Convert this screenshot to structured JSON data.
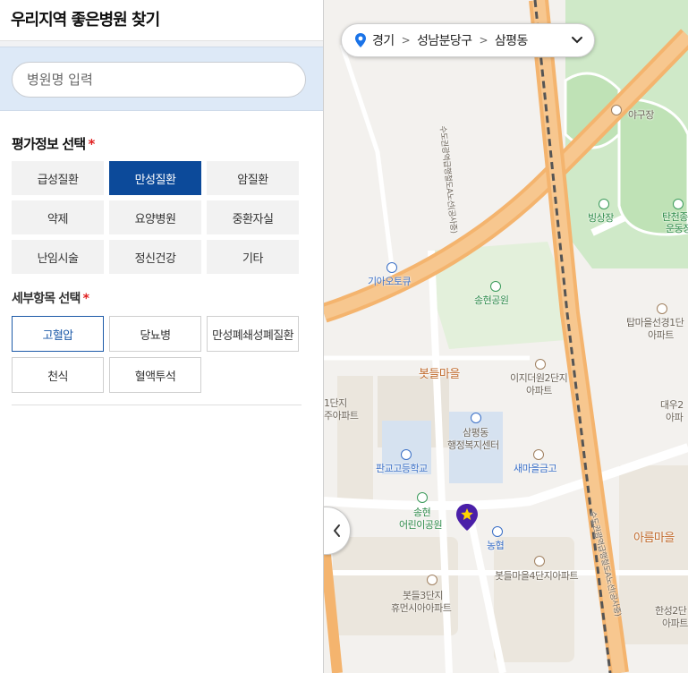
{
  "panel": {
    "title": "우리지역 좋은병원 찾기",
    "search_placeholder": "병원명 입력",
    "eval_title": "평가정보 선택",
    "required_mark": "*",
    "eval_items": [
      {
        "label": "급성질환",
        "active": false
      },
      {
        "label": "만성질환",
        "active": true
      },
      {
        "label": "암질환",
        "active": false
      },
      {
        "label": "약제",
        "active": false
      },
      {
        "label": "요양병원",
        "active": false
      },
      {
        "label": "중환자실",
        "active": false
      },
      {
        "label": "난임시술",
        "active": false
      },
      {
        "label": "정신건강",
        "active": false
      },
      {
        "label": "기타",
        "active": false
      }
    ],
    "detail_title": "세부항목 선택",
    "detail_items": [
      {
        "label": "고혈압",
        "active": true
      },
      {
        "label": "당뇨병",
        "active": false
      },
      {
        "label": "만성폐쇄성폐질환",
        "active": false
      },
      {
        "label": "천식",
        "active": false
      },
      {
        "label": "혈액투석",
        "active": false
      }
    ]
  },
  "map": {
    "breadcrumb": [
      "경기",
      "성남분당구",
      "삼평동"
    ],
    "labels": {
      "baseball": "야구장",
      "ice_rink": "빙상장",
      "tancheon_1": "탄천종",
      "tancheon_2": "운동장",
      "kia": "기아오토큐",
      "songhyun_park": "송현공원",
      "tapmaeul_1": "탑마을선경1단",
      "tapmaeul_2": "아파트",
      "botdeul": "봇들마을",
      "ijidium_1": "이지더원2단지",
      "ijidium_2": "아파트",
      "danji1_1": "1단지",
      "danji1_2": "주아파트",
      "daewoo_1": "대우2",
      "daewoo_2": "아파",
      "office_1": "삼평동",
      "office_2": "행정복지센터",
      "school": "판교고등학교",
      "mg": "새마을금고",
      "kids_park_1": "송현",
      "kids_park_2": "어린이공원",
      "nonghyup": "농협",
      "areum": "아름마을",
      "botdeul4": "봇들마을4단지아파트",
      "botdeul3_1": "봇들3단지",
      "botdeul3_2": "휴먼시아아파트",
      "hanseong_1": "한성2단",
      "hanseong_2": "아파트",
      "rail_top": "수도권광역급행철도A노선(공사중)",
      "rail_bottom": "수도권광역급행철도A노선(공사중)"
    }
  },
  "colors": {
    "accent": "#0c4a9a",
    "road": "#f4b46e",
    "park": "#cde9c6",
    "pin": "#4a1fa8"
  }
}
